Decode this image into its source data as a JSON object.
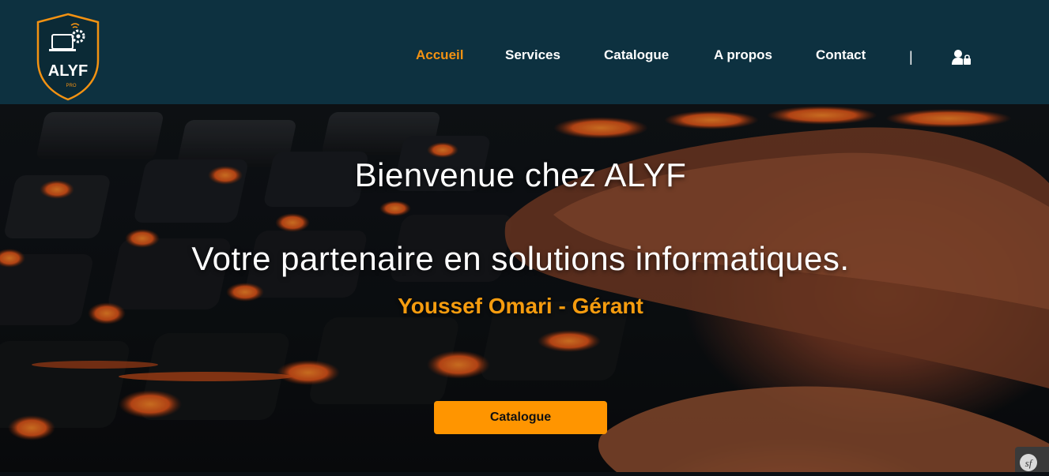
{
  "brand": {
    "logo_text": "ALYF",
    "logo_subtext": "PRO",
    "colors": {
      "navbar": "#0d3140",
      "accent": "#f39212",
      "button": "#ff9500"
    }
  },
  "nav": {
    "items": [
      {
        "label": "Accueil",
        "active": true
      },
      {
        "label": "Services",
        "active": false
      },
      {
        "label": "Catalogue",
        "active": false
      },
      {
        "label": "A propos",
        "active": false
      },
      {
        "label": "Contact",
        "active": false
      }
    ],
    "separator": "|",
    "account_icon": "user-lock-icon"
  },
  "hero": {
    "title": "Bienvenue chez ALYF",
    "subtitle": "Votre partenaire en solutions informatiques.",
    "author": "Youssef Omari - Gérant",
    "cta_label": "Catalogue",
    "background": "keyboard-finger-image"
  },
  "debug_toolbar": {
    "icon": "symfony-icon",
    "glyph": "sf"
  }
}
